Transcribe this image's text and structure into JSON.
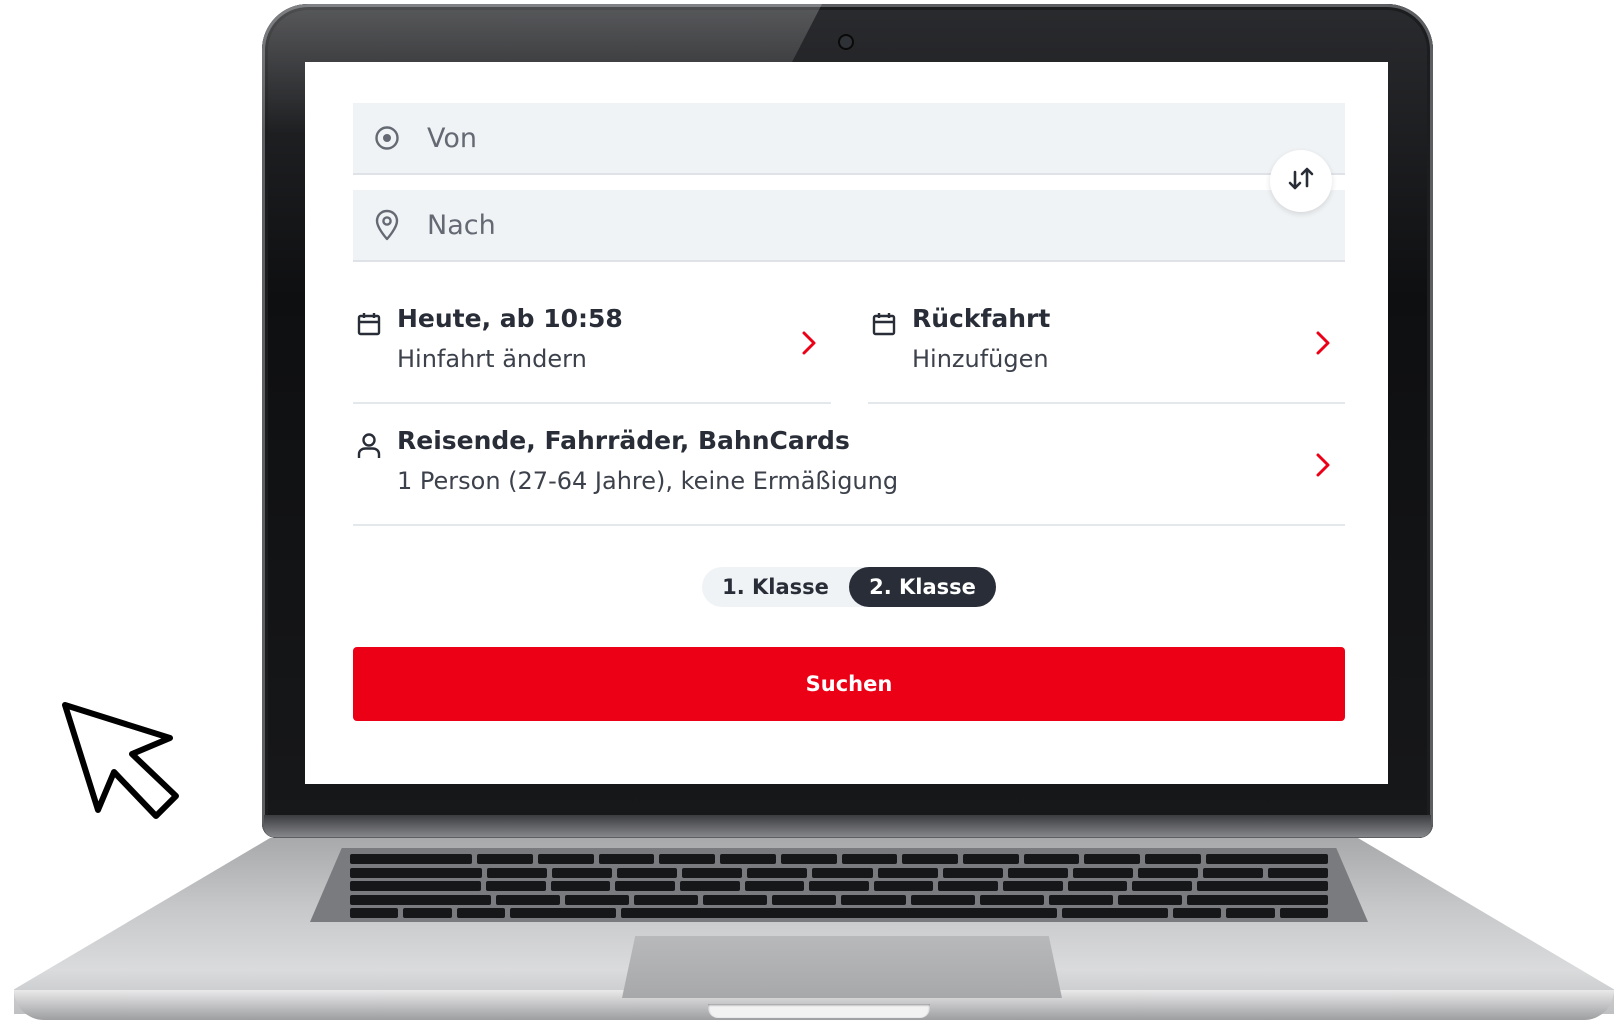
{
  "form": {
    "from": {
      "placeholder": "Von",
      "value": ""
    },
    "to": {
      "placeholder": "Nach",
      "value": ""
    },
    "outbound": {
      "title": "Heute, ab 10:58",
      "subtitle": "Hinfahrt ändern"
    },
    "return_trip": {
      "title": "Rückfahrt",
      "subtitle": "Hinzufügen"
    },
    "travellers": {
      "title": "Reisende, Fahrräder, BahnCards",
      "subtitle": "1 Person (27-64 Jahre), keine Ermäßigung"
    },
    "travel_class": {
      "options": [
        "1. Klasse",
        "2. Klasse"
      ],
      "selected": "2. Klasse"
    },
    "search_label": "Suchen"
  },
  "icons": {
    "from": "location-target-icon",
    "to": "map-pin-icon",
    "swap": "swap-arrows-icon",
    "outbound": "calendar-icon",
    "return_trip": "calendar-icon",
    "travellers": "person-icon",
    "chevron": "chevron-right-icon",
    "cursor": "mouse-pointer-icon"
  },
  "colors": {
    "accent": "#ec0016",
    "text": "#282d37",
    "field_background": "#f0f3f5",
    "active_toggle": "#282d37"
  }
}
